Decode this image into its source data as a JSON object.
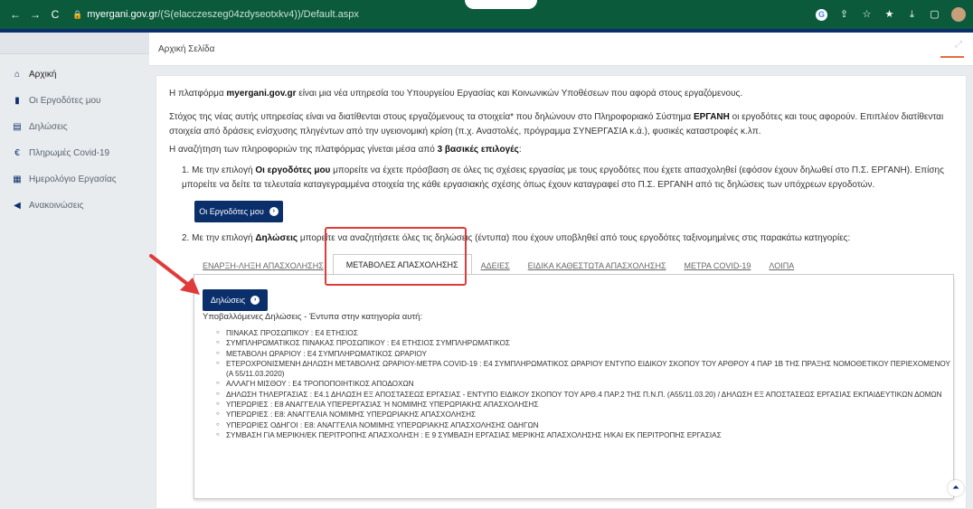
{
  "browser": {
    "url_host": "myergani.gov.gr",
    "url_path": "/(S(elacczeszeg04zdyseotxkv4))/Default.aspx",
    "back_glyph": "←",
    "forward_glyph": "→",
    "reload_glyph": "C",
    "lock_glyph": "🔒",
    "icons": [
      "G",
      "⇪",
      "☆",
      "★",
      "⤓",
      "▢"
    ]
  },
  "sidebar": {
    "items": [
      {
        "label": "Αρχική",
        "icon": "home-icon",
        "glyph": "⌂"
      },
      {
        "label": "Οι Εργοδότες μου",
        "icon": "document-icon",
        "glyph": "▮"
      },
      {
        "label": "Δηλώσεις",
        "icon": "list-icon",
        "glyph": "▤"
      },
      {
        "label": "Πληρωμές Covid-19",
        "icon": "euro-icon",
        "glyph": "€"
      },
      {
        "label": "Ημερολόγιο Εργασίας",
        "icon": "calendar-icon",
        "glyph": "▦"
      },
      {
        "label": "Ανακοινώσεις",
        "icon": "megaphone-icon",
        "glyph": "◀"
      }
    ]
  },
  "header": {
    "title": "Αρχική Σελίδα",
    "expand_glyph": "⤢"
  },
  "content": {
    "intro_pre": "Η πλατφόρμα ",
    "intro_brand": "myergani.gov.gr",
    "intro_post": " είναι μια νέα υπηρεσία του Υπουργείου Εργασίας και Κοινωνικών Υποθέσεων που αφορά στους εργαζόμενους.",
    "goal_pre": "Στόχος της νέας αυτής υπηρεσίας είναι να διατίθενται στους εργαζόμενους τα στοιχεία* που δηλώνουν στο Πληροφοριακό Σύστημα ",
    "goal_brand": "ΕΡΓΑΝΗ",
    "goal_post": " οι εργοδότες και τους αφορούν. Επιπλέον διατίθενται στοιχεία από δράσεις ενίσχυσης πληγέντων από την υγειονομική κρίση (π.χ. Αναστολές, πρόγραμμα ΣΥΝΕΡΓΑΣΙΑ κ.ά.), φυσικές καταστροφές κ.λπ.",
    "search_pre": "Η αναζήτηση των πληροφοριών της πλατφόρμας γίνεται μέσα από ",
    "search_bold": "3 βασικές επιλογές",
    "search_post": ":",
    "opt1_pre": "1. Με την επιλογή ",
    "opt1_bold": "Οι εργοδότες μου",
    "opt1_post": " μπορείτε να έχετε πρόσβαση σε όλες τις σχέσεις εργασίας με τους εργοδότες που έχετε απασχοληθεί (εφόσον έχουν δηλωθεί στο Π.Σ. ΕΡΓΑΝΗ). Επίσης μπορείτε να δείτε τα τελευταία καταγεγραμμένα στοιχεία της κάθε εργασιακής σχέσης όπως έχουν καταγραφεί στο Π.Σ. ΕΡΓΑΝΗ από τις δηλώσεις των υπόχρεων εργοδοτών.",
    "employers_button": "Οι Εργοδότες μου",
    "opt2_pre": "2. Με την επιλογή ",
    "opt2_bold": "Δηλώσεις",
    "opt2_post": " μπορείτε να αναζητήσετε όλες τις δηλώσεις (έντυπα) που έχουν υποβληθεί από τους εργοδότες ταξινομημένες στις παρακάτω κατηγορίες:",
    "tabs": [
      "ΕΝΑΡΞΗ-ΛΗΞΗ ΑΠΑΣΧΟΛΗΣΗΣ",
      "ΜΕΤΑΒΟΛΕΣ ΑΠΑΣΧΟΛΗΣΗΣ",
      "ΑΔΕΙΕΣ",
      "ΕΙΔΙΚΑ ΚΑΘΕΣΤΩΤΑ ΑΠΑΣΧΟΛΗΣΗΣ",
      "ΜΕΤΡΑ COVID-19",
      "ΛΟΙΠΑ"
    ],
    "declarations_button": "Δηλώσεις",
    "panel_subtitle": "Υποβαλλόμενες Δηλώσεις - Έντυπα στην κατηγορία αυτή:",
    "declarations": [
      "ΠΙΝΑΚΑΣ ΠΡΟΣΩΠΙΚΟΥ : Ε4 ΕΤΗΣΙΟΣ",
      "ΣΥΜΠΛΗΡΩΜΑΤΙΚΟΣ ΠΙΝΑΚΑΣ ΠΡΟΣΩΠΙΚΟΥ : Ε4 ΕΤΗΣΙΟΣ ΣΥΜΠΛΗΡΩΜΑΤΙΚΟΣ",
      "ΜΕΤΑΒΟΛΗ ΩΡΑΡΙΟΥ : Ε4 ΣΥΜΠΛΗΡΩΜΑΤΙΚΟΣ ΩΡΑΡΙΟΥ",
      "ΕΤΕΡΟΧΡΟΝΙΣΜΕΝΗ ΔΗΛΩΣΗ ΜΕΤΑΒΟΛΗΣ ΩΡΑΡΙΟΥ-ΜΕΤΡΑ COVID-19 : Ε4 ΣΥΜΠΛΗΡΩΜΑΤΙΚΟΣ ΩΡΑΡΙΟΥ ΕΝΤΥΠΟ ΕΙΔΙΚΟΥ ΣΚΟΠΟΥ ΤΟΥ ΑΡΘΡΟΥ 4 ΠΑΡ 1Β ΤΗΣ ΠΡΑΞΗΣ ΝΟΜΟΘΕΤΙΚΟΥ ΠΕΡΙΕΧΟΜΕΝΟΥ (Α 55/11.03.2020)",
      "ΑΛΛΑΓΗ ΜΙΣΘΟΥ : Ε4 ΤΡΟΠΟΠΟΙΗΤΙΚΟΣ ΑΠΟΔΟΧΩΝ",
      "ΔΗΛΩΣΗ ΤΗΛΕΡΓΑΣΙΑΣ : Ε4.1 ΔΗΛΩΣΗ ΕΞ ΑΠΟΣΤΑΣΕΩΣ ΕΡΓΑΣΙΑΣ - ΕΝΤΥΠΟ ΕΙΔΙΚΟΥ ΣΚΟΠΟΥ ΤΟΥ ΑΡΘ.4 ΠΑΡ.2 ΤΗΣ Π.Ν.Π. (Α55/11.03.20) / ΔΗΛΩΣΗ ΕΞ ΑΠΟΣΤΑΣΕΩΣ ΕΡΓΑΣΙΑΣ ΕΚΠΑΙΔΕΥΤΙΚΩΝ ΔΟΜΩΝ",
      "ΥΠΕΡΩΡΙΕΣ : Ε8 ΑΝΑΓΓΕΛΙΑ ΥΠΕΡΕΡΓΑΣΙΑΣ Ή ΝΟΜΙΜΗΣ ΥΠΕΡΩΡΙΑΚΗΣ ΑΠΑΣΧΟΛΗΣΗΣ",
      "ΥΠΕΡΩΡΙΕΣ : Ε8: ΑΝΑΓΓΕΛΙΑ ΝΟΜΙΜΗΣ ΥΠΕΡΩΡΙΑΚΗΣ ΑΠΑΣΧΟΛΗΣΗΣ",
      "ΥΠΕΡΩΡΙΕΣ ΟΔΗΓΟΙ : Ε8: ΑΝΑΓΓΕΛΙΑ ΝΟΜΙΜΗΣ ΥΠΕΡΩΡΙΑΚΗΣ ΑΠΑΣΧΟΛΗΣΗΣ ΟΔΗΓΩΝ",
      "ΣΥΜΒΑΣΗ ΓΙΑ ΜΕΡΙΚΗ/ΕΚ ΠΕΡΙΤΡΟΠΗΣ ΑΠΑΣΧΟΛΗΣΗ : Ε 9 ΣΥΜΒΑΣΗ ΕΡΓΑΣΙΑΣ ΜΕΡΙΚΗΣ ΑΠΑΣΧΟΛΗΣΗΣ Η/ΚΑΙ ΕΚ ΠΕΡΙΤΡΟΠΗΣ ΕΡΓΑΣΙΑΣ"
    ],
    "scroll_up_glyph": "⏶"
  },
  "colors": {
    "primary": "#0a2f6b",
    "browser": "#0b5a3c",
    "highlight": "#e03b3b",
    "accent": "#e46d3d"
  }
}
